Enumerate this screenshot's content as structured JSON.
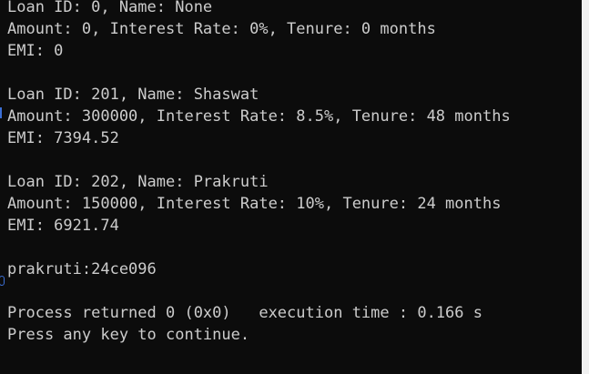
{
  "console": {
    "lines": [
      "Loan ID: 0, Name: None",
      "Amount: 0, Interest Rate: 0%, Tenure: 0 months",
      "EMI: 0",
      "",
      "Loan ID: 201, Name: Shaswat",
      "Amount: 300000, Interest Rate: 8.5%, Tenure: 48 months",
      "EMI: 7394.52",
      "",
      "Loan ID: 202, Name: Prakruti",
      "Amount: 150000, Interest Rate: 10%, Tenure: 24 months",
      "EMI: 6921.74",
      "",
      "prakruti:24ce096",
      "",
      "Process returned 0 (0x0)   execution time : 0.166 s",
      "Press any key to continue."
    ]
  },
  "colors": {
    "background": "#0c0c0c",
    "text": "#cccccc",
    "scrollbar": "#f0f0f0"
  }
}
